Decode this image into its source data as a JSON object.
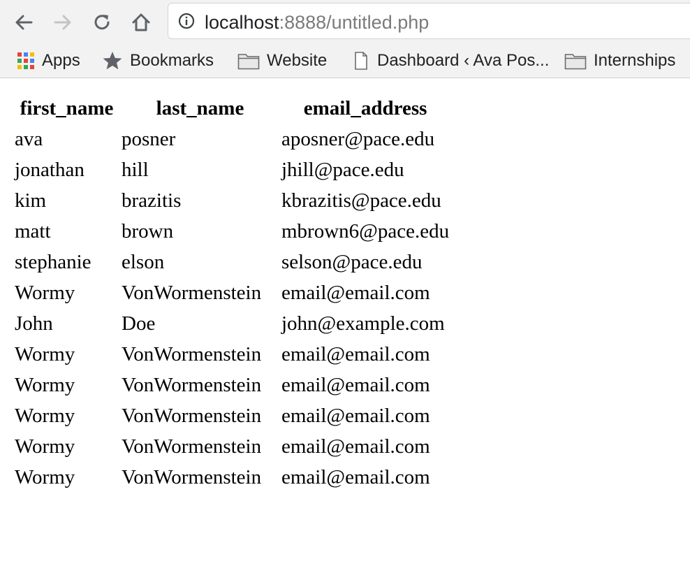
{
  "browser": {
    "url_host": "localhost",
    "url_rest": ":8888/untitled.php"
  },
  "bookmarks": [
    {
      "label": "Apps",
      "icon": "apps-grid-icon"
    },
    {
      "label": "Bookmarks",
      "icon": "star-icon"
    },
    {
      "label": "Website",
      "icon": "folder-icon"
    },
    {
      "label": "Dashboard ‹ Ava Pos...",
      "icon": "page-icon"
    },
    {
      "label": "Internships",
      "icon": "folder-icon"
    }
  ],
  "table": {
    "headers": [
      "first_name",
      "last_name",
      "email_address"
    ],
    "rows": [
      [
        "ava",
        "posner",
        "aposner@pace.edu"
      ],
      [
        "jonathan",
        "hill",
        "jhill@pace.edu"
      ],
      [
        "kim",
        "brazitis",
        "kbrazitis@pace.edu"
      ],
      [
        "matt",
        "brown",
        "mbrown6@pace.edu"
      ],
      [
        "stephanie",
        "elson",
        "selson@pace.edu"
      ],
      [
        "Wormy",
        "VonWormenstein",
        "email@email.com"
      ],
      [
        "John",
        "Doe",
        "john@example.com"
      ],
      [
        "Wormy",
        "VonWormenstein",
        "email@email.com"
      ],
      [
        "Wormy",
        "VonWormenstein",
        "email@email.com"
      ],
      [
        "Wormy",
        "VonWormenstein",
        "email@email.com"
      ],
      [
        "Wormy",
        "VonWormenstein",
        "email@email.com"
      ],
      [
        "Wormy",
        "VonWormenstein",
        "email@email.com"
      ]
    ]
  }
}
